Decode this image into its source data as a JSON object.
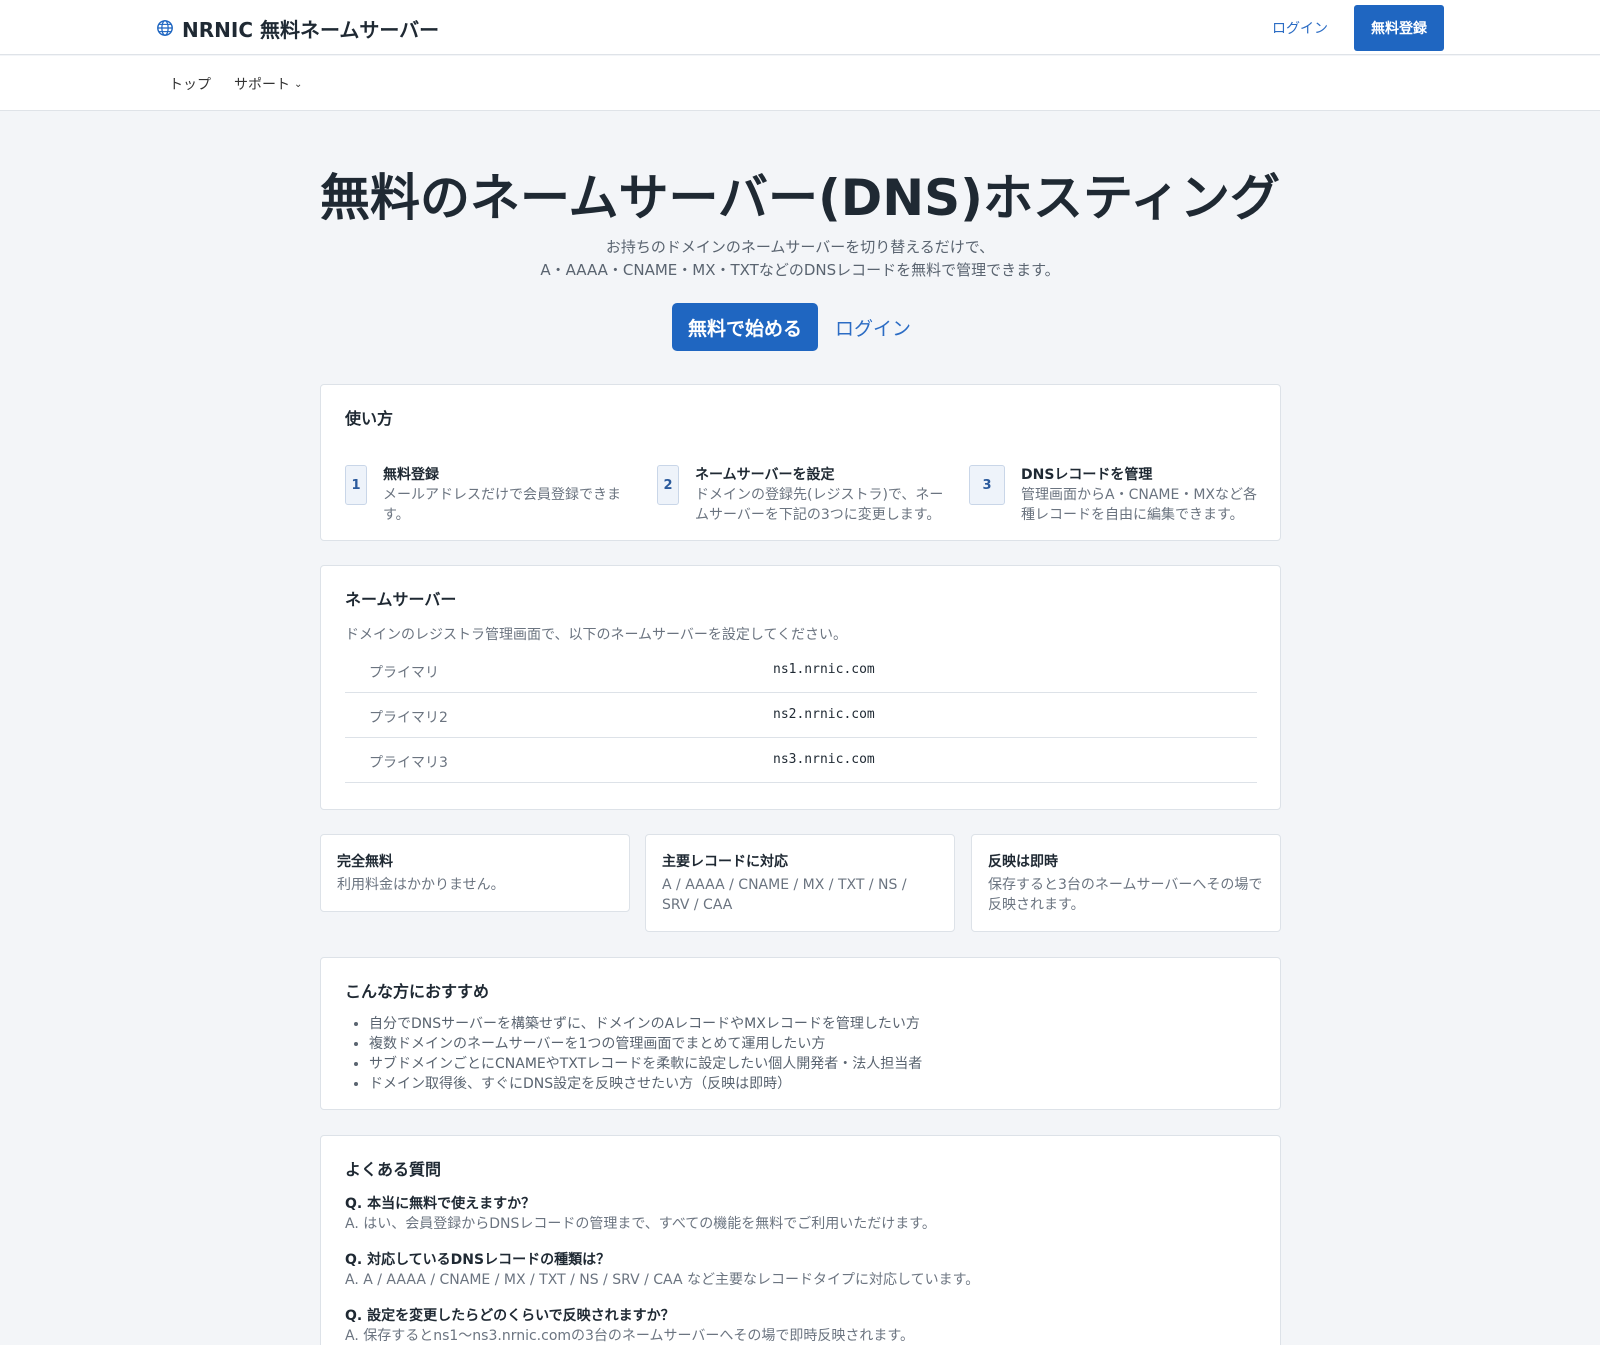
{
  "header": {
    "brand": "NRNIC 無料ネームサーバー",
    "brand_icon": "globe-icon",
    "login": "ログイン",
    "signup": "無料登録"
  },
  "nav": {
    "top": "トップ",
    "support": "サポート",
    "support_icon": "chevron-down-icon"
  },
  "hero": {
    "title": "無料のネームサーバー(DNS)ホスティング",
    "sub_line1": "お持ちのドメインのネームサーバーを切り替えるだけで、",
    "sub_line2": "A・AAAA・CNAME・MX・TXTなどのDNSレコードを無料で管理できます。",
    "cta_start": "無料で始める",
    "cta_login": "ログイン"
  },
  "how_to": {
    "title": "使い方",
    "steps": [
      {
        "num": "1",
        "title": "無料登録",
        "desc": "メールアドレスだけで会員登録できます。"
      },
      {
        "num": "2",
        "title": "ネームサーバーを設定",
        "desc": "ドメインの登録先(レジストラ)で、ネームサーバーを下記の3つに変更します。"
      },
      {
        "num": "3",
        "title": "DNSレコードを管理",
        "desc": "管理画面からA・CNAME・MXなど各種レコードを自由に編集できます。"
      }
    ]
  },
  "nameservers": {
    "title": "ネームサーバー",
    "desc": "ドメインのレジストラ管理画面で、以下のネームサーバーを設定してください。",
    "rows": [
      {
        "label": "プライマリ",
        "value": "ns1.nrnic.com"
      },
      {
        "label": "プライマリ2",
        "value": "ns2.nrnic.com"
      },
      {
        "label": "プライマリ3",
        "value": "ns3.nrnic.com"
      }
    ]
  },
  "features": [
    {
      "title": "完全無料",
      "desc": "利用料金はかかりません。"
    },
    {
      "title": "主要レコードに対応",
      "desc": "A / AAAA / CNAME / MX / TXT / NS / SRV / CAA"
    },
    {
      "title": "反映は即時",
      "desc": "保存すると3台のネームサーバーへその場で反映されます。"
    }
  ],
  "recommend": {
    "title": "こんな方におすすめ",
    "items": [
      "自分でDNSサーバーを構築せずに、ドメインのAレコードやMXレコードを管理したい方",
      "複数ドメインのネームサーバーを1つの管理画面でまとめて運用したい方",
      "サブドメインごとにCNAMEやTXTレコードを柔軟に設定したい個人開発者・法人担当者",
      "ドメイン取得後、すぐにDNS設定を反映させたい方（反映は即時）"
    ]
  },
  "faq": {
    "title": "よくある質問",
    "items": [
      {
        "q": "Q. 本当に無料で使えますか？",
        "a": "A. はい、会員登録からDNSレコードの管理まで、すべての機能を無料でご利用いただけます。"
      },
      {
        "q": "Q. 対応しているDNSレコードの種類は？",
        "a": "A. A / AAAA / CNAME / MX / TXT / NS / SRV / CAA など主要なレコードタイプに対応しています。"
      },
      {
        "q": "Q. 設定を変更したらどのくらいで反映されますか？",
        "a": "A. 保存するとns1〜ns3.nrnic.comの3台のネームサーバーへその場で即時反映されます。"
      }
    ]
  },
  "colors": {
    "accent": "#1f66c1",
    "link": "#2b6cc4",
    "background": "#f3f5f8"
  }
}
